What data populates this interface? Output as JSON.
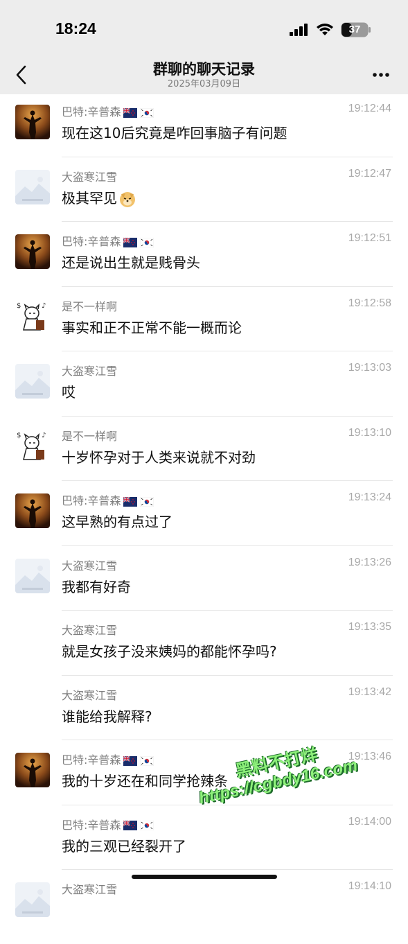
{
  "status_bar": {
    "time": "18:24",
    "battery": "37"
  },
  "nav": {
    "title": "群聊的聊天记录",
    "subtitle": "2025年03月09日"
  },
  "messages": [
    {
      "sender": "巴特:辛普森",
      "flags": true,
      "time": "19:12:44",
      "text": "现在这10后究竟是咋回事脑子有问题",
      "avatar": "movie"
    },
    {
      "sender": "大盗寒江雪",
      "flags": false,
      "time": "19:12:47",
      "text": "极其罕见",
      "avatar": "placeholder",
      "emoji": "doge"
    },
    {
      "sender": "巴特:辛普森",
      "flags": true,
      "time": "19:12:51",
      "text": "还是说出生就是贱骨头",
      "avatar": "movie"
    },
    {
      "sender": "是不一样啊",
      "flags": false,
      "time": "19:12:58",
      "text": "事实和正不正常不能一概而论",
      "avatar": "cat"
    },
    {
      "sender": "大盗寒江雪",
      "flags": false,
      "time": "19:13:03",
      "text": "哎",
      "avatar": "placeholder"
    },
    {
      "sender": "是不一样啊",
      "flags": false,
      "time": "19:13:10",
      "text": "十岁怀孕对于人类来说就不对劲",
      "avatar": "cat"
    },
    {
      "sender": "巴特:辛普森",
      "flags": true,
      "time": "19:13:24",
      "text": "这早熟的有点过了",
      "avatar": "movie"
    },
    {
      "sender": "大盗寒江雪",
      "flags": false,
      "time": "19:13:26",
      "text": "我都有好奇",
      "avatar": "placeholder"
    },
    {
      "sender": "大盗寒江雪",
      "flags": false,
      "time": "19:13:35",
      "text": "就是女孩子没来姨妈的都能怀孕吗?",
      "avatar": "none"
    },
    {
      "sender": "大盗寒江雪",
      "flags": false,
      "time": "19:13:42",
      "text": "谁能给我解释?",
      "avatar": "none"
    },
    {
      "sender": "巴特:辛普森",
      "flags": true,
      "time": "19:13:46",
      "text": "我的十岁还在和同学抢辣条",
      "avatar": "movie"
    },
    {
      "sender": "巴特:辛普森",
      "flags": true,
      "time": "19:14:00",
      "text": "我的三观已经裂开了",
      "avatar": "none"
    },
    {
      "sender": "大盗寒江雪",
      "flags": false,
      "time": "19:14:10",
      "text": "",
      "avatar": "placeholder"
    }
  ],
  "watermark": {
    "line1": "黑料不打烊",
    "line2": "https://cgbdy16.com"
  },
  "icons": {
    "back": "chevron-left-icon",
    "more": "more-dots-icon",
    "signal": "cellular-signal-icon",
    "wifi": "wifi-icon",
    "battery": "battery-icon"
  }
}
